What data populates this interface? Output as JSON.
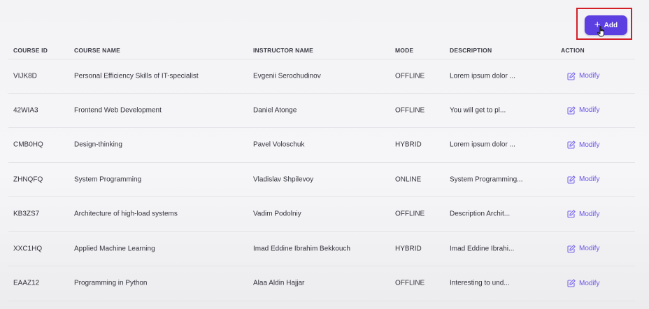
{
  "toolbar": {
    "add_label": "Add",
    "add_icon": "plus-icon"
  },
  "colors": {
    "accent": "#5b3fe0",
    "link": "#6a55e6",
    "highlight": "#d31f26"
  },
  "table": {
    "columns": [
      "COURSE ID",
      "COURSE NAME",
      "INSTRUCTOR NAME",
      "MODE",
      "DESCRIPTION",
      "ACTION"
    ],
    "rows": [
      {
        "id": "VIJK8D",
        "name": "Personal Efficiency Skills of IT-specialist",
        "instructor": "Evgenii Serochudinov",
        "mode": "OFFLINE",
        "description": "Lorem ipsum dolor ...",
        "action": "Modify"
      },
      {
        "id": "42WIA3",
        "name": "Frontend Web Development",
        "instructor": "Daniel Atonge",
        "mode": "OFFLINE",
        "description": "You will get to pl...",
        "action": "Modify"
      },
      {
        "id": "CMB0HQ",
        "name": "Design-thinking",
        "instructor": "Pavel Voloschuk",
        "mode": "HYBRID",
        "description": "Lorem ipsum dolor ...",
        "action": "Modify"
      },
      {
        "id": "ZHNQFQ",
        "name": "System Programming",
        "instructor": "Vladislav Shpilevoy",
        "mode": "ONLINE",
        "description": "System Programming...",
        "action": "Modify"
      },
      {
        "id": "KB3ZS7",
        "name": "Architecture of high-load systems",
        "instructor": "Vadim Podolniy",
        "mode": "OFFLINE",
        "description": "Description Archit...",
        "action": "Modify"
      },
      {
        "id": "XXC1HQ",
        "name": "Applied Machine Learning",
        "instructor": "Imad Eddine Ibrahim Bekkouch",
        "mode": "HYBRID",
        "description": "Imad Eddine Ibrahi...",
        "action": "Modify"
      },
      {
        "id": "EAAZ12",
        "name": "Programming in Python",
        "instructor": "Alaa Aldin Hajjar",
        "mode": "OFFLINE",
        "description": "Interesting to und...",
        "action": "Modify"
      }
    ]
  }
}
